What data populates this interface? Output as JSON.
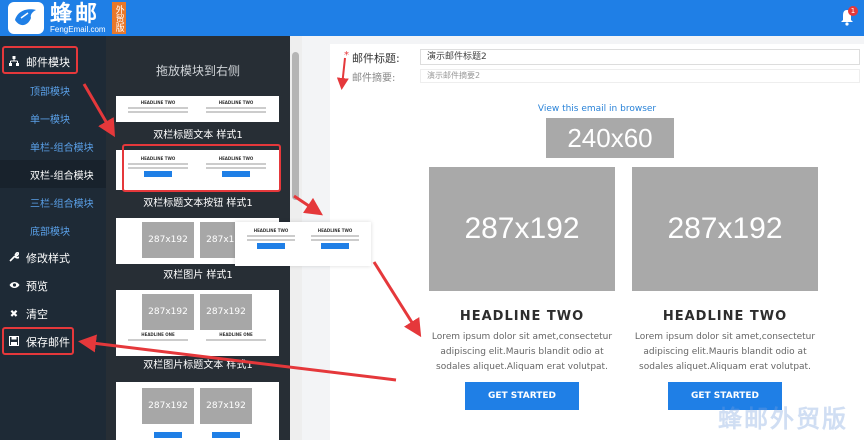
{
  "brand": {
    "name": "蜂邮",
    "site": "FengEmail.com",
    "badge": "外贸版",
    "color": "#1f7fe6",
    "badge_color": "#e8782a"
  },
  "header": {
    "notification_count": "1"
  },
  "nav": {
    "items": [
      {
        "label": "邮件模块",
        "icon": "sitemap-icon"
      },
      {
        "label": "顶部模块"
      },
      {
        "label": "单一模块"
      },
      {
        "label": "单栏-组合模块"
      },
      {
        "label": "双栏-组合模块"
      },
      {
        "label": "三栏-组合模块"
      },
      {
        "label": "底部模块"
      },
      {
        "label": "修改样式",
        "icon": "wrench-icon"
      },
      {
        "label": "预览",
        "icon": "eye-icon"
      },
      {
        "label": "清空",
        "icon": "x-icon"
      },
      {
        "label": "保存邮件",
        "icon": "save-icon"
      }
    ]
  },
  "panel": {
    "title": "拖放模块到右侧",
    "modules": [
      {
        "label": "双栏标题文本 样式1",
        "thumb_headline": "HEADLINE TWO"
      },
      {
        "label": "双栏标题文本按钮 样式1",
        "thumb_headline": "HEADLINE TWO",
        "thumb_button": "GET STARTED"
      },
      {
        "label": "双栏图片 样式1",
        "thumb_img": "287x192"
      },
      {
        "label": "双栏图片标题文本 样式1",
        "thumb_img": "287x192",
        "thumb_headline": "HEADLINE ONE"
      },
      {
        "label": "",
        "thumb_img": "287x192"
      }
    ]
  },
  "drag_preview": {
    "headline": "HEADLINE TWO",
    "button": "GET STARTED"
  },
  "form": {
    "title_label": "邮件标题:",
    "title_required": "*",
    "title_value": "演示邮件标题2",
    "summary_label": "邮件摘要:",
    "summary_value": "演示邮件摘要2"
  },
  "email": {
    "view_link": "View this email in browser",
    "logo_placeholder": "240x60",
    "columns": [
      {
        "image": "287x192",
        "headline": "HEADLINE TWO",
        "body": "Lorem ipsum dolor sit amet,consectetur adipiscing elit.Mauris blandit odio at sodales aliquet.Aliquam erat volutpat.",
        "button": "GET STARTED"
      },
      {
        "image": "287x192",
        "headline": "HEADLINE TWO",
        "body": "Lorem ipsum dolor sit amet,consectetur adipiscing elit.Mauris blandit odio at sodales aliquet.Aliquam erat volutpat.",
        "button": "GET STARTED"
      }
    ]
  },
  "watermark": "蜂邮外贸版"
}
